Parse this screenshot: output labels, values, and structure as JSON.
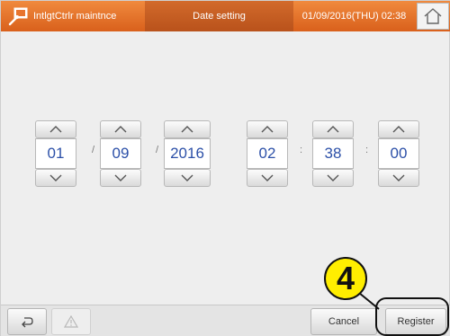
{
  "header": {
    "app_title": "IntlgtCtrlr maintnce",
    "screen_title": "Date setting",
    "datetime": "01/09/2016(THU) 02:38"
  },
  "date_time": {
    "month": "01",
    "day": "09",
    "year": "2016",
    "hour": "02",
    "minute": "38",
    "second": "00",
    "date_separator": "/",
    "time_separator": ":"
  },
  "footer": {
    "cancel_label": "Cancel",
    "register_label": "Register"
  },
  "callout": {
    "step_number": "4"
  },
  "colors": {
    "header_orange": "#e8742e",
    "value_blue": "#2c50a8",
    "callout_yellow": "#ffee00"
  },
  "icons": [
    "tool-icon",
    "home-icon",
    "chevron-up-icon",
    "chevron-down-icon",
    "back-icon",
    "warning-icon"
  ]
}
